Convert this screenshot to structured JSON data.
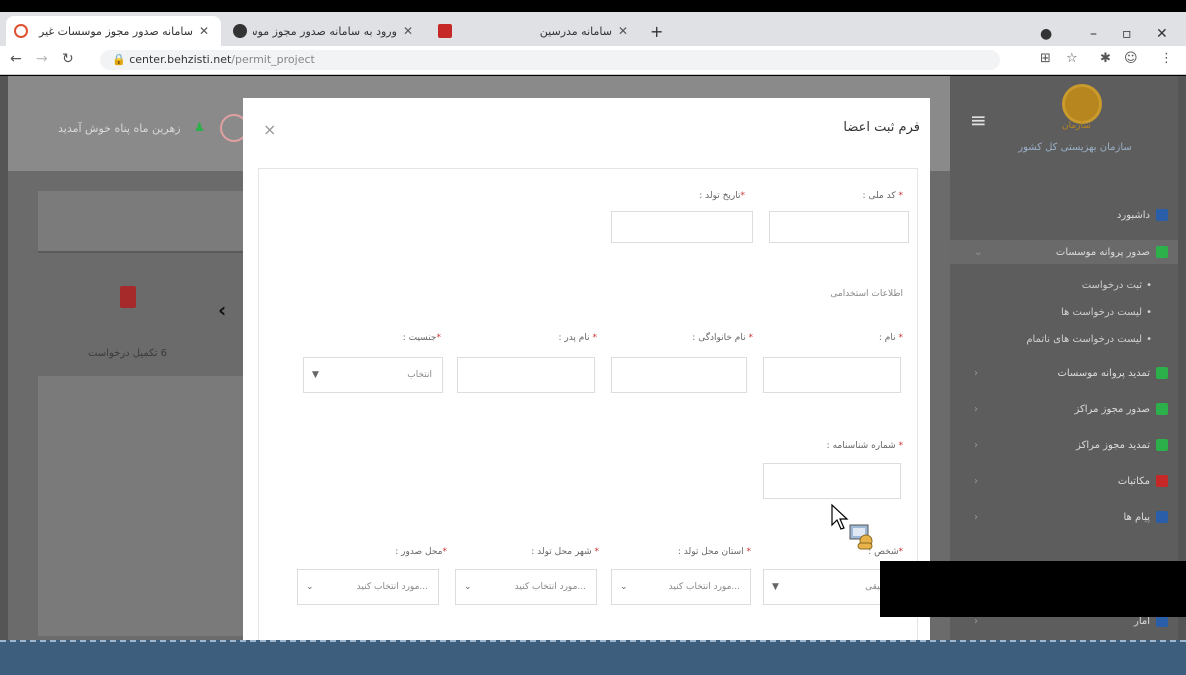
{
  "browser": {
    "tabs": [
      {
        "title": "سامانه صدور مجوز موسسات غیر",
        "active": true
      },
      {
        "title": "ورود به سامانه صدور مجوز موسسات",
        "active": false
      },
      {
        "title": "سامانه مدرسین",
        "active": false
      }
    ],
    "new_tab": "+",
    "url_host": "center.behzisti.net",
    "url_path": "/permit_project"
  },
  "page": {
    "user_greeting": "زهرین ماه پناه خوش آمدید",
    "incomplete_label": "6 تکمیل درخواست",
    "nav_arrow": "‹"
  },
  "sidebar": {
    "logo_sub": "سازمان",
    "org_name": "سازمان بهزیستی کل کشور",
    "items": [
      {
        "label": "داشبورد",
        "color": "#2b5ea8"
      },
      {
        "label": "صدور پروانه موسسات",
        "color": "#2bb04a"
      },
      {
        "label": "تمدید پروانه موسسات",
        "color": "#2bb04a"
      },
      {
        "label": "صدور مجوز مراکز",
        "color": "#2bb04a"
      },
      {
        "label": "تمدید مجوز مراکز",
        "color": "#2bb04a"
      },
      {
        "label": "مکاتبات",
        "color": "#c62828"
      },
      {
        "label": "پیام ها",
        "color": "#2b5ea8"
      },
      {
        "label": "آمار",
        "color": "#2b5ea8"
      }
    ],
    "sub_items": [
      "ثبت درخواست",
      "لیست درخواست ها",
      "لیست درخواست های ناتمام"
    ]
  },
  "modal": {
    "title": "فرم ثبت اعضا",
    "close": "×",
    "fields": {
      "national_code": "کد ملی :",
      "birth_date": "تاریخ تولد :",
      "employment_section": "اطلاعات استخدامی",
      "first_name": "نام :",
      "last_name": "نام خانوادگی :",
      "father_name": "نام پدر :",
      "gender": "جنسیت :",
      "gender_value": "انتخاب",
      "id_number": "شماره شناسنامه :",
      "person_type": "شخص :",
      "person_type_value": "حقیقی",
      "birth_province": "استان محل تولد :",
      "birth_city": "شهر محل تولد :",
      "issue_place": "محل صدور :",
      "select_placeholder": "...مورد انتخاب کنید"
    }
  }
}
